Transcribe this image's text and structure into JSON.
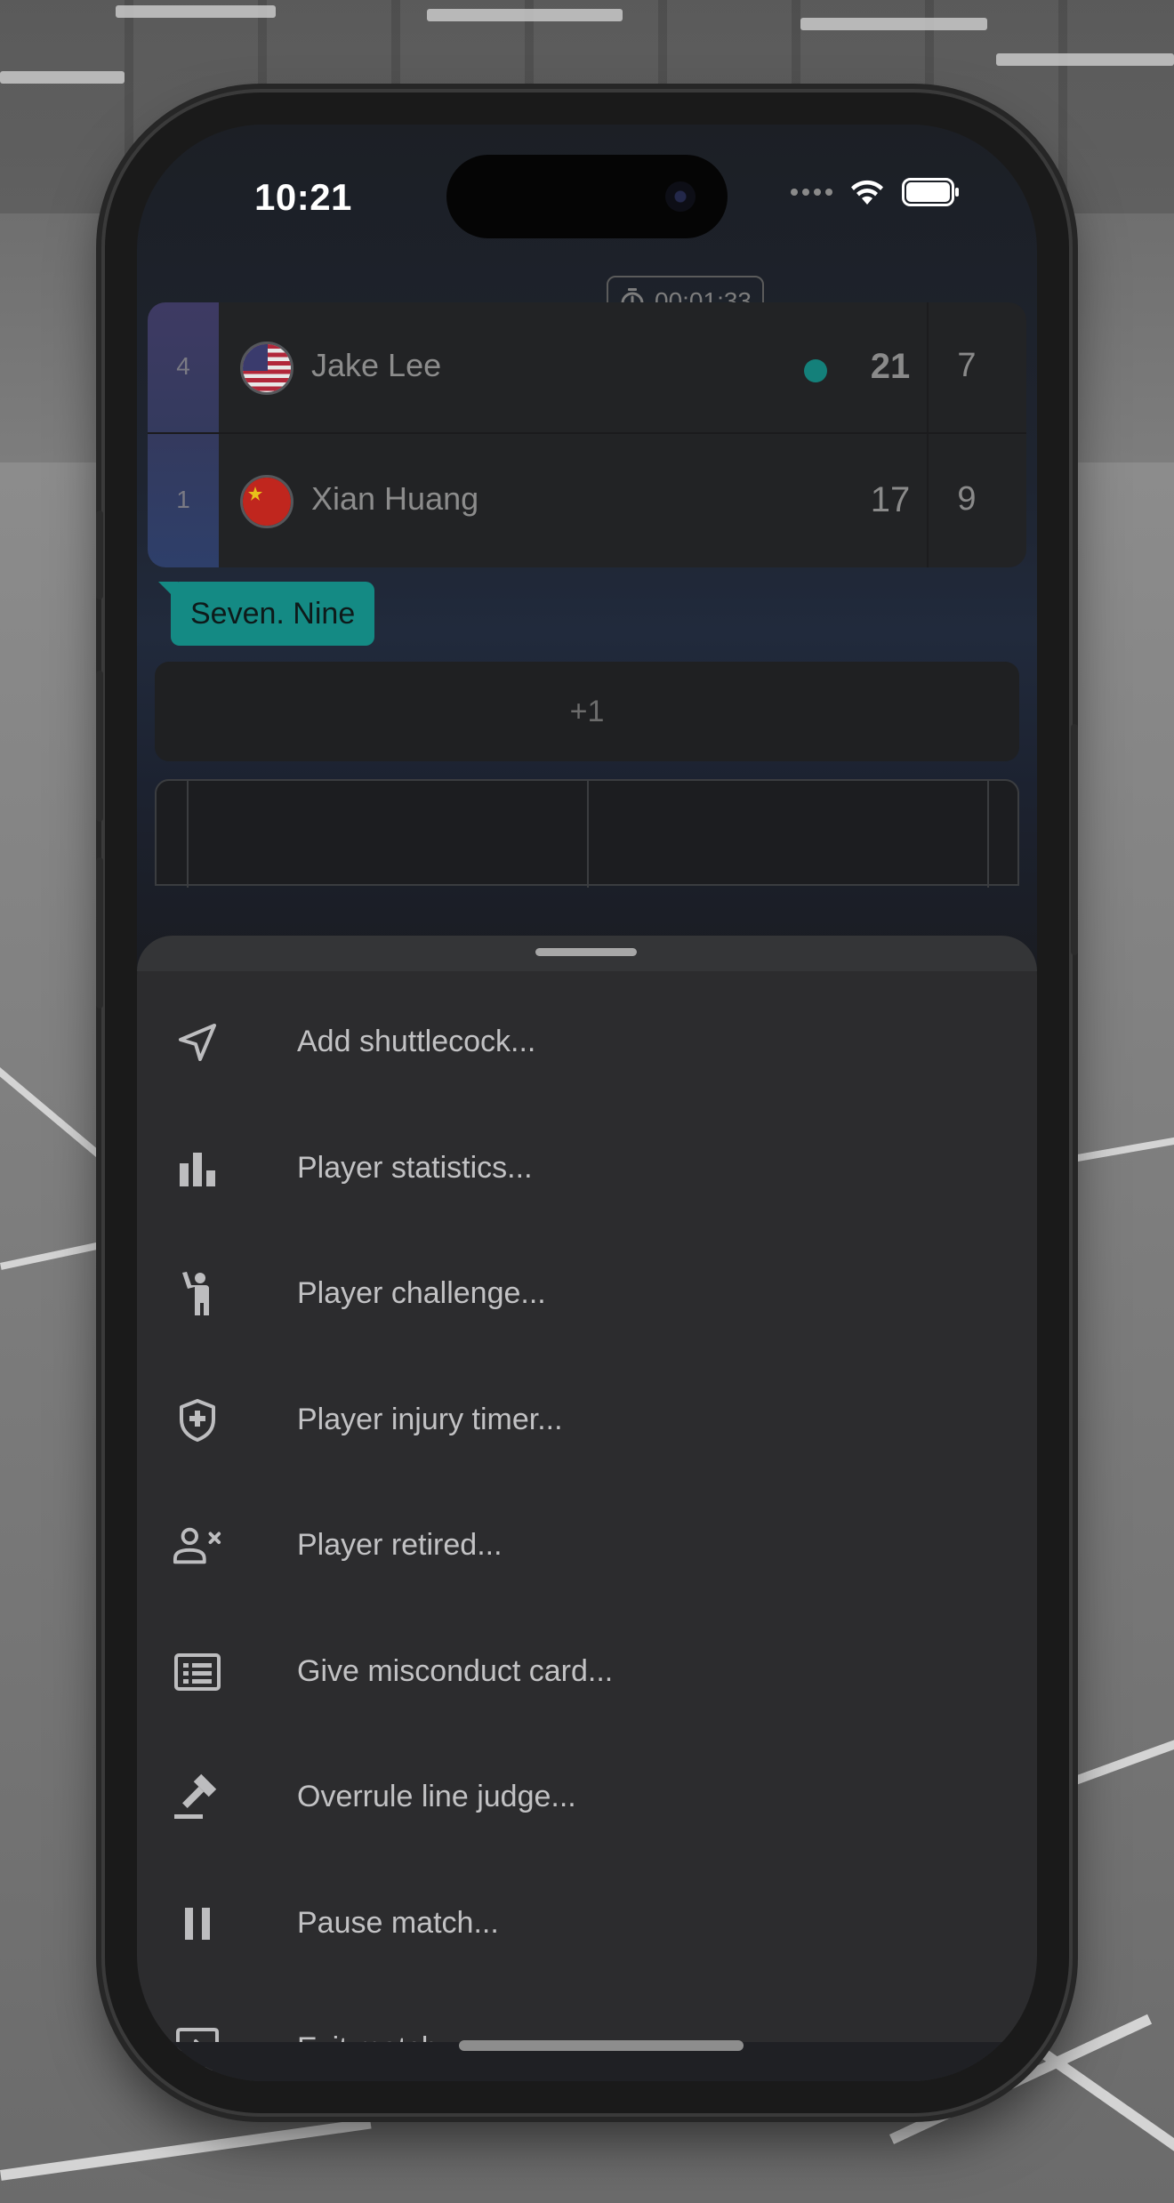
{
  "status_bar": {
    "time": "10:21",
    "icons": [
      "signal-dots-icon",
      "wifi-icon",
      "battery-icon"
    ]
  },
  "match": {
    "elapsed_time": "00:01:33",
    "players": [
      {
        "seed": "4",
        "name": "Jake Lee",
        "flag": "usa-flag-icon",
        "serving": true,
        "current_game_score": "21",
        "games_score": "7"
      },
      {
        "seed": "1",
        "name": "Xian Huang",
        "flag": "china-flag-icon",
        "serving": false,
        "current_game_score": "17",
        "games_score": "9"
      }
    ],
    "announcement": "Seven. Nine",
    "point_button_label": "+1"
  },
  "menu": {
    "items": [
      {
        "label": "Add shuttlecock...",
        "icon": "send-arrow-icon"
      },
      {
        "label": "Player statistics...",
        "icon": "bar-chart-icon"
      },
      {
        "label": "Player challenge...",
        "icon": "person-raising-hand-icon"
      },
      {
        "label": "Player injury timer...",
        "icon": "shield-plus-icon"
      },
      {
        "label": "Player retired...",
        "icon": "person-remove-icon"
      },
      {
        "label": "Give misconduct card...",
        "icon": "list-card-icon"
      },
      {
        "label": "Overrule line judge...",
        "icon": "gavel-icon"
      },
      {
        "label": "Pause match...",
        "icon": "pause-icon"
      },
      {
        "label": "Exit match...",
        "icon": "exit-icon"
      }
    ]
  },
  "colors": {
    "accent_teal": "#148a84",
    "serve_dot": "#14807a",
    "sheet_bg": "#2c2c2e",
    "menu_text": "#c2c2c4"
  }
}
